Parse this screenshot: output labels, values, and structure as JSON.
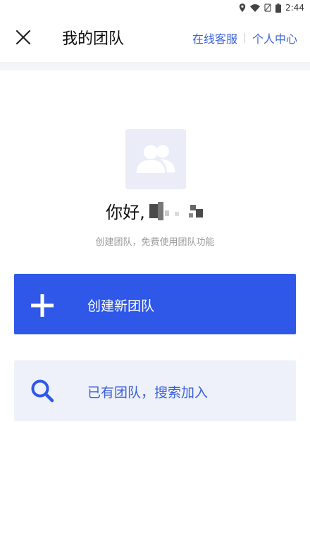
{
  "status_bar": {
    "time": "2:44",
    "icons": [
      "location-icon",
      "wifi-icon",
      "no-sim-icon",
      "battery-icon"
    ]
  },
  "header": {
    "close_icon": "close-icon",
    "title": "我的团队",
    "links": {
      "customer_service": "在线客服",
      "personal_center": "个人中心"
    }
  },
  "profile": {
    "avatar_icon": "team-users-icon",
    "greeting": "你好,",
    "subtitle": "创建团队，免费使用团队功能"
  },
  "actions": {
    "create": {
      "icon": "plus-icon",
      "label": "创建新团队"
    },
    "join": {
      "icon": "search-icon",
      "label": "已有团队，搜索加入"
    }
  },
  "colors": {
    "primary": "#2f58e8",
    "link": "#3b62d8",
    "join_bg": "#eef1fa",
    "avatar_bg": "#eaedf8"
  }
}
